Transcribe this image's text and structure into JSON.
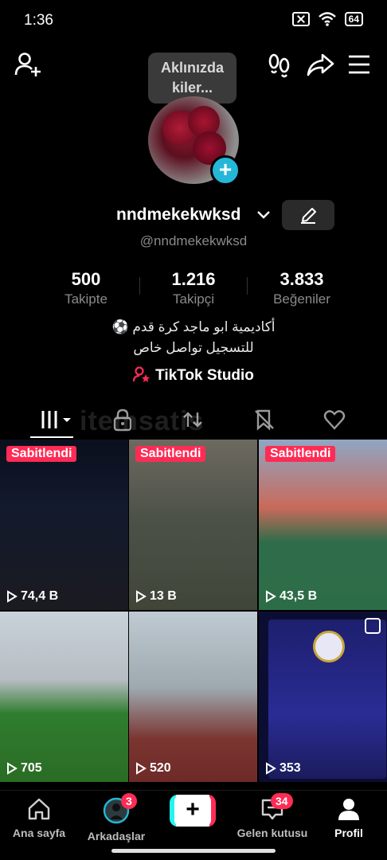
{
  "status_bar": {
    "time": "1:36",
    "battery": "64"
  },
  "header": {
    "tooltip": "Aklınızda kiler...",
    "icons": [
      "add-friend-icon",
      "footprints-icon",
      "share-icon",
      "menu-icon"
    ]
  },
  "profile": {
    "username": "nndmekekwksd",
    "handle": "@nndmekekwksd",
    "stats": [
      {
        "value": "500",
        "label": "Takipte"
      },
      {
        "value": "1.216",
        "label": "Takipçi"
      },
      {
        "value": "3.833",
        "label": "Beğeniler"
      }
    ],
    "bio_line1": "أكاديمية ابو ماجد كرة قدم ⚽",
    "bio_line2": "للتسجيل تواصل خاص",
    "studio_label": "TikTok Studio"
  },
  "watermark": "itemsatis",
  "videos": [
    {
      "pinned_label": "Sabitlendi",
      "views": "74,4 B"
    },
    {
      "pinned_label": "Sabitlendi",
      "views": "13 B"
    },
    {
      "pinned_label": "Sabitlendi",
      "views": "43,5 B"
    },
    {
      "views": "705"
    },
    {
      "views": "520"
    },
    {
      "views": "353"
    }
  ],
  "bottom_nav": {
    "home": "Ana sayfa",
    "friends": "Arkadaşlar",
    "friends_badge": "3",
    "inbox": "Gelen kutusu",
    "inbox_badge": "34",
    "profile": "Profil"
  },
  "colors": {
    "accent": "#fe2c55",
    "cyan": "#24b7d8",
    "muted": "#8a8a8a"
  }
}
